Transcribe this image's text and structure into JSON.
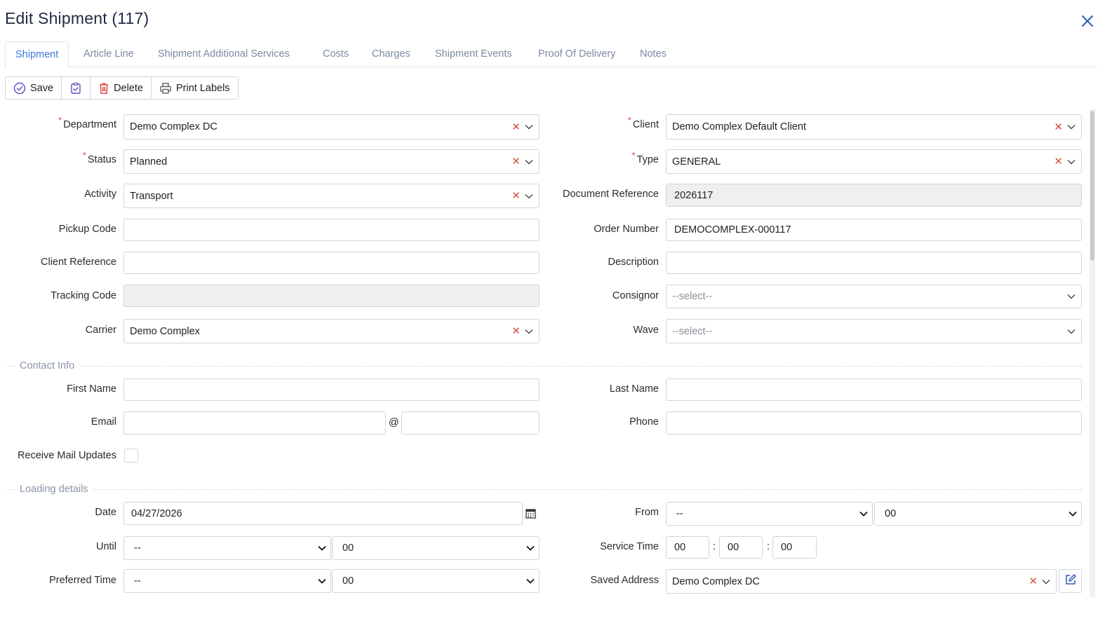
{
  "window": {
    "title": "Edit Shipment (117)"
  },
  "tabs": [
    {
      "label": "Shipment"
    },
    {
      "label": "Article Line"
    },
    {
      "label": "Shipment Additional Services"
    },
    {
      "label": "Costs"
    },
    {
      "label": "Charges"
    },
    {
      "label": "Shipment Events"
    },
    {
      "label": "Proof Of Delivery"
    },
    {
      "label": "Notes"
    }
  ],
  "toolbar": {
    "save_label": "Save",
    "delete_label": "Delete",
    "print_label": "Print Labels"
  },
  "form": {
    "department": {
      "label": "Department",
      "value": "Demo Complex DC"
    },
    "status": {
      "label": "Status",
      "value": "Planned"
    },
    "activity": {
      "label": "Activity",
      "value": "Transport"
    },
    "pickup_code": {
      "label": "Pickup Code",
      "value": ""
    },
    "client_reference": {
      "label": "Client Reference",
      "value": ""
    },
    "tracking_code": {
      "label": "Tracking Code",
      "value": ""
    },
    "carrier": {
      "label": "Carrier",
      "value": "Demo Complex"
    },
    "client": {
      "label": "Client",
      "value": "Demo Complex Default Client"
    },
    "type": {
      "label": "Type",
      "value": "GENERAL"
    },
    "document_reference": {
      "label": "Document Reference",
      "value": "2026117"
    },
    "order_number": {
      "label": "Order Number",
      "value": "DEMOCOMPLEX-000117"
    },
    "description": {
      "label": "Description",
      "value": ""
    },
    "consignor": {
      "label": "Consignor",
      "placeholder": "--select--"
    },
    "wave": {
      "label": "Wave",
      "placeholder": "--select--"
    }
  },
  "contact": {
    "section_title": "Contact Info",
    "first_name": {
      "label": "First Name",
      "value": ""
    },
    "last_name": {
      "label": "Last Name",
      "value": ""
    },
    "email": {
      "label": "Email",
      "local": "",
      "domain": "",
      "at_symbol": "@"
    },
    "phone": {
      "label": "Phone",
      "value": ""
    },
    "receive_mail_updates": {
      "label": "Receive Mail Updates",
      "checked": false
    }
  },
  "loading": {
    "section_title": "Loading details",
    "date": {
      "label": "Date",
      "value": "04/27/2026"
    },
    "from": {
      "label": "From",
      "hour": "--",
      "minute": "00"
    },
    "until": {
      "label": "Until",
      "hour": "--",
      "minute": "00"
    },
    "service_time": {
      "label": "Service Time",
      "hours": "00",
      "minutes": "00",
      "seconds": "00",
      "separator": ":"
    },
    "preferred_time": {
      "label": "Preferred Time",
      "hour": "--",
      "minute": "00"
    },
    "saved_address": {
      "label": "Saved Address",
      "value": "Demo Complex DC"
    }
  },
  "colors": {
    "accent": "#3b78d6",
    "title": "#1f2a44",
    "clear_icon": "#d4513d",
    "delete_icon": "#d9433a",
    "save_icon": "#6a4bc4"
  },
  "icons": [
    "close-icon",
    "check-circle-icon",
    "clipboard-check-icon",
    "trash-icon",
    "printer-icon",
    "clear-icon",
    "chevron-down-icon",
    "calendar-icon",
    "edit-icon"
  ]
}
